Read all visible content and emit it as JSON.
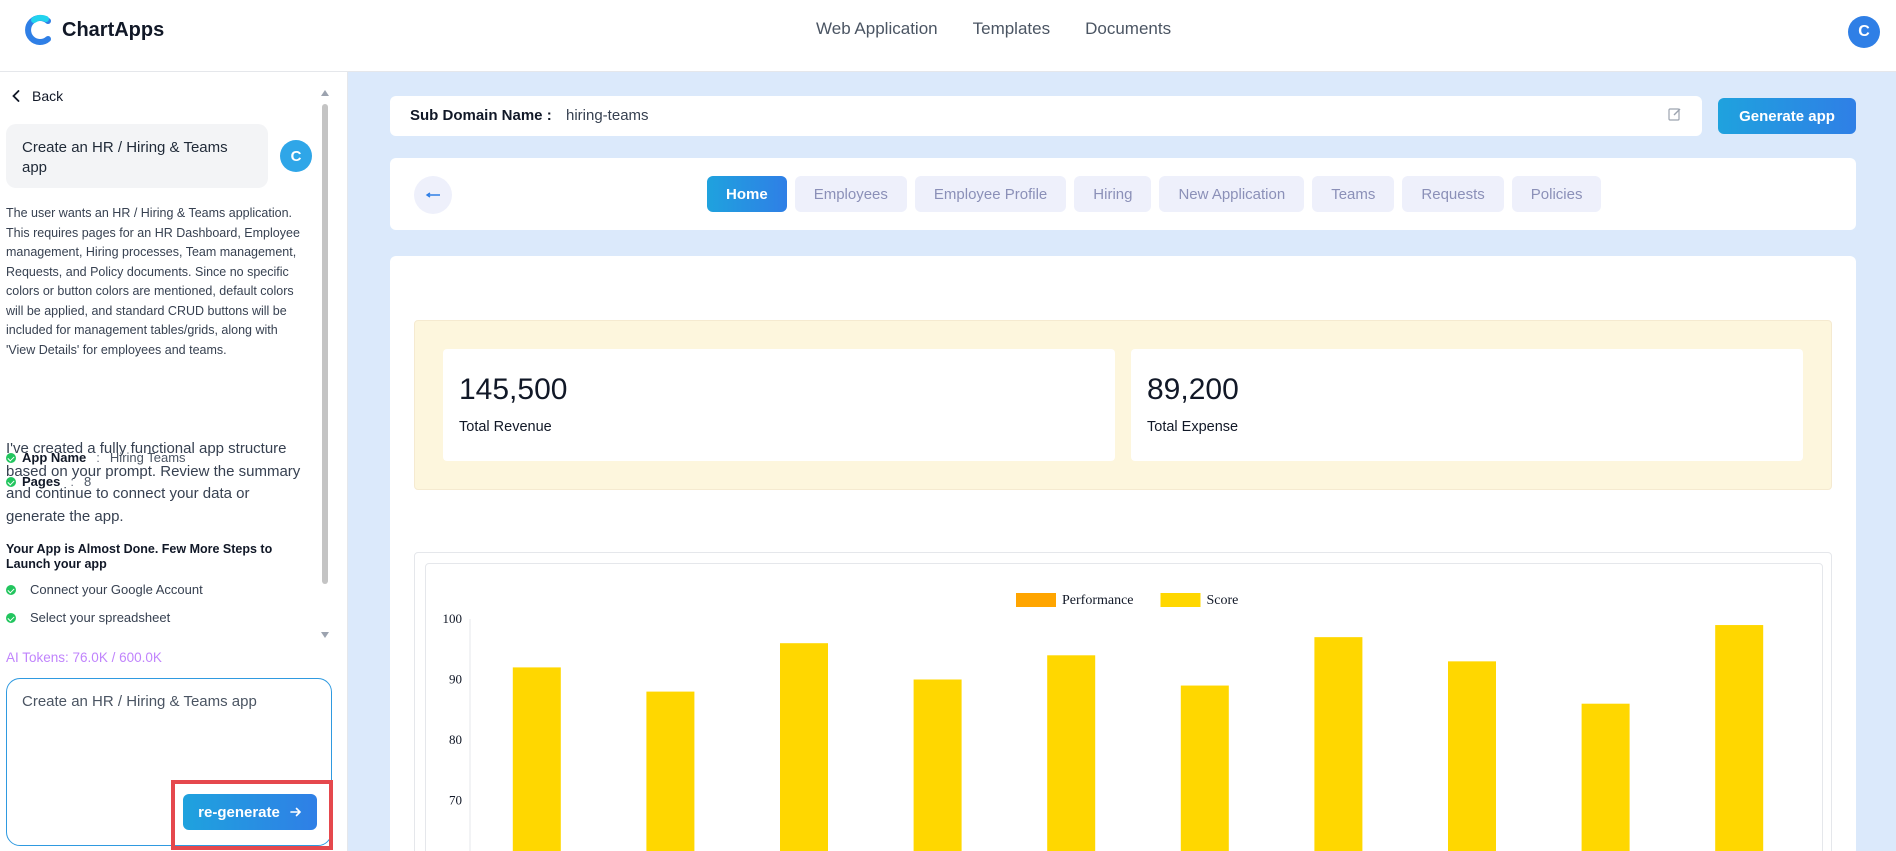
{
  "header": {
    "brand": "ChartApps",
    "nav": [
      "Web Application",
      "Templates",
      "Documents"
    ],
    "avatar_initial": "C"
  },
  "sidebar": {
    "back_label": "Back",
    "prompt_bubble": "Create an HR / Hiring & Teams app",
    "avatar_initial": "C",
    "summary": "The user wants an HR / Hiring & Teams application. This requires pages for an HR Dashboard, Employee management, Hiring processes, Team management, Requests, and Policy documents. Since no specific colors or button colors are mentioned, default colors will be applied, and standard CRUD buttons will be included for management tables/grids, along with 'View Details' for employees and teams.",
    "app_name_label": "App Name",
    "app_name_value": "Hiring Teams",
    "pages_label": "Pages",
    "pages_value": "8",
    "created_message": "I've created a fully functional app structure based on your prompt. Review the summary and continue to connect your data or generate the app.",
    "almost_done": "Your App is Almost Done. Few More Steps to Launch your app",
    "steps": [
      "Connect your Google Account",
      "Select your spreadsheet"
    ],
    "tokens": "AI Tokens: 76.0K / 600.0K",
    "prompt_input_value": "Create an HR / Hiring & Teams app",
    "regenerate_label": "re-generate"
  },
  "main": {
    "subdomain_label": "Sub Domain Name :",
    "subdomain_value": "hiring-teams",
    "generate_label": "Generate app",
    "tabs": [
      "Home",
      "Employees",
      "Employee Profile",
      "Hiring",
      "New Application",
      "Teams",
      "Requests",
      "Policies"
    ],
    "active_tab": "Home",
    "stats": [
      {
        "value": "145,500",
        "label": "Total Revenue"
      },
      {
        "value": "89,200",
        "label": "Total Expense"
      }
    ]
  },
  "colors": {
    "accent": "#2f7fe6",
    "performance": "#ffa500",
    "score": "#ffd700"
  },
  "chart_data": {
    "type": "bar",
    "series": [
      {
        "name": "Performance",
        "values": []
      },
      {
        "name": "Score",
        "values": [
          92,
          88,
          96,
          90,
          94,
          89,
          97,
          93,
          86,
          99
        ]
      }
    ],
    "yticks": [
      70,
      80,
      90,
      100
    ],
    "ylim": [
      60,
      100
    ],
    "legend": "top-center"
  }
}
